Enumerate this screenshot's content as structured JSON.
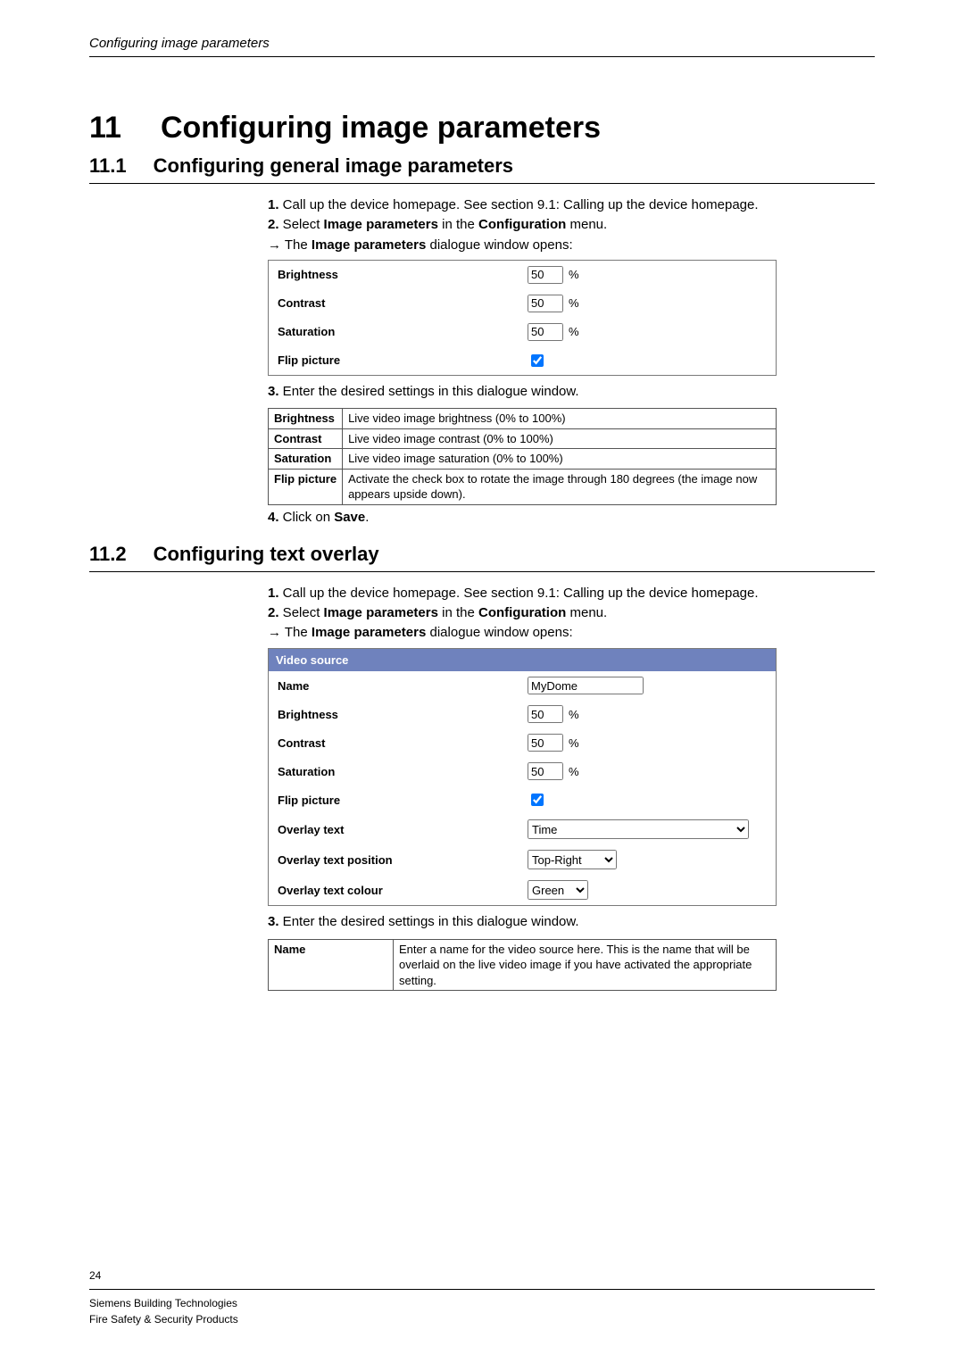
{
  "running_header": "Configuring image parameters",
  "chapter": {
    "num": "11",
    "title": "Configuring image parameters"
  },
  "sec1": {
    "num": "11.1",
    "title": "Configuring general image parameters",
    "steps": {
      "s1": {
        "n": "1.",
        "text": " Call up the device homepage. See section 9.1: Calling up the device homepage."
      },
      "s2": {
        "n": "2.",
        "pre": " Select ",
        "b1": "Image parameters",
        "mid": " in the ",
        "b2": "Configuration",
        "post": " menu."
      },
      "arrow": {
        "sym": "→",
        "pre": " The ",
        "b": "Image parameters",
        "post": " dialogue window opens:"
      },
      "s3": {
        "n": "3.",
        "text": " Enter the desired settings in this dialogue window."
      },
      "s4": {
        "n": "4.",
        "pre": " Click on ",
        "b": "Save",
        "post": "."
      }
    },
    "dialog": {
      "brightness": {
        "label": "Brightness",
        "value": "50",
        "unit": "%"
      },
      "contrast": {
        "label": "Contrast",
        "value": "50",
        "unit": "%"
      },
      "saturation": {
        "label": "Saturation",
        "value": "50",
        "unit": "%"
      },
      "flip": {
        "label": "Flip picture",
        "checked": true
      }
    },
    "table": {
      "brightness": {
        "term": "Brightness",
        "desc": "Live video image brightness (0% to 100%)"
      },
      "contrast": {
        "term": "Contrast",
        "desc": "Live video image contrast (0% to 100%)"
      },
      "saturation": {
        "term": "Saturation",
        "desc": "Live video image saturation (0% to 100%)"
      },
      "flip": {
        "term": "Flip picture",
        "desc": "Activate the check box to rotate the image through 180 degrees (the image now appears upside down)."
      }
    }
  },
  "sec2": {
    "num": "11.2",
    "title": "Configuring text overlay",
    "steps": {
      "s1": {
        "n": "1.",
        "text": " Call up the device homepage. See section 9.1: Calling up the device homepage."
      },
      "s2": {
        "n": "2.",
        "pre": " Select ",
        "b1": "Image parameters",
        "mid": " in the ",
        "b2": "Configuration",
        "post": " menu."
      },
      "arrow": {
        "sym": "→",
        "pre": " The ",
        "b": "Image parameters",
        "post": " dialogue window opens:"
      },
      "s3": {
        "n": "3.",
        "text": " Enter the desired settings in this dialogue window."
      }
    },
    "dialog": {
      "header": "Video source",
      "name": {
        "label": "Name",
        "value": "MyDome"
      },
      "brightness": {
        "label": "Brightness",
        "value": "50",
        "unit": "%"
      },
      "contrast": {
        "label": "Contrast",
        "value": "50",
        "unit": "%"
      },
      "saturation": {
        "label": "Saturation",
        "value": "50",
        "unit": "%"
      },
      "flip": {
        "label": "Flip picture",
        "checked": true
      },
      "overlay_text": {
        "label": "Overlay text",
        "value": "Time"
      },
      "overlay_pos": {
        "label": "Overlay text position",
        "value": "Top-Right"
      },
      "overlay_color": {
        "label": "Overlay text colour",
        "value": "Green"
      }
    },
    "table": {
      "name": {
        "term": "Name",
        "desc": "Enter a name for the video source here. This is the name that will be overlaid on the live video image if you have activated the appropriate setting."
      }
    }
  },
  "footer": {
    "page": "24",
    "line1": "Siemens Building Technologies",
    "line2": "Fire Safety & Security Products"
  }
}
